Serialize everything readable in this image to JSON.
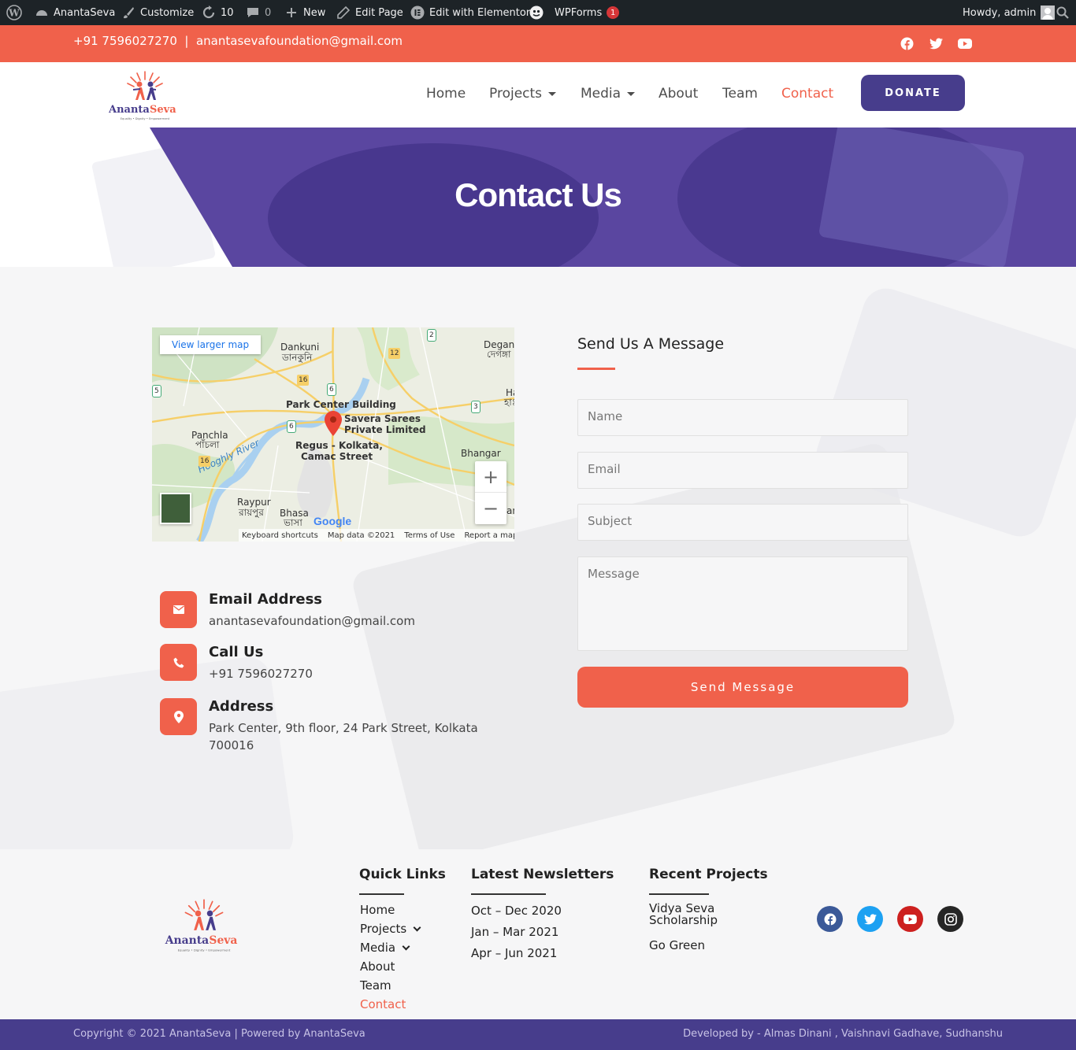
{
  "admin_bar": {
    "site_name": "AnantaSeva",
    "customize": "Customize",
    "updates_count": "10",
    "comments_count": "0",
    "new_label": "New",
    "edit_page": "Edit Page",
    "edit_elementor": "Edit with Elementor",
    "wpforms": "WPForms",
    "wpforms_badge": "1",
    "howdy": "Howdy, admin"
  },
  "topbar": {
    "contact_line": "+91 7596027270  |  anantasevafoundation@gmail.com",
    "social_icons": [
      "facebook-icon",
      "twitter-icon",
      "youtube-icon"
    ]
  },
  "brand": {
    "name": "Ananta Seva",
    "name_part1": "Ananta",
    "name_part2": "Seva",
    "tagline": "Equality • Dignity • Empowerment"
  },
  "nav": {
    "items": [
      {
        "label": "Home"
      },
      {
        "label": "Projects"
      },
      {
        "label": "Media"
      },
      {
        "label": "About"
      },
      {
        "label": "Team"
      },
      {
        "label": "Contact"
      }
    ],
    "donate_label": "DONATE"
  },
  "hero": {
    "title": "Contact Us"
  },
  "map": {
    "view_larger": "View larger map",
    "labels": {
      "dankuni": "Dankuni",
      "dankuni_bn": "ডানকুনি",
      "degang": "Degang",
      "degang_bn": "দেগঙ্গা",
      "park_center": "Park Center Building",
      "savera": "Savera Sarees",
      "savera2": "Private Limited",
      "regus": "Regus - Kolkata,",
      "regus2": "Camac Street",
      "panchla": "Panchla",
      "panchla_bn": "পাঁচলা",
      "bhangar": "Bhangar",
      "hooghly": "Hooghly River",
      "raypur": "Raypur",
      "raypur_bn": "রায়পুর",
      "bhasa": "Bhasa",
      "bhasa_bn": "ভাসা",
      "ha": "Ha",
      "ha_bn": "হাঃ",
      "an": "an",
      "road_16a": "16",
      "road_16b": "16",
      "road_6a": "6",
      "road_6b": "6",
      "road_12": "12",
      "road_2": "2",
      "road_3": "3",
      "road_5": "5"
    },
    "google": "Google",
    "keyboard": "Keyboard shortcuts",
    "mapdata": "Map data ©2021",
    "terms": "Terms of Use",
    "report": "Report a map error"
  },
  "contact_info": {
    "email_title": "Email Address",
    "email_value": "anantasevafoundation@gmail.com",
    "call_title": "Call Us",
    "call_value": "+91 7596027270",
    "address_title": "Address",
    "address_value": "Park Center, 9th floor, 24 Park Street, Kolkata 700016"
  },
  "form": {
    "title": "Send Us A Message",
    "name_placeholder": "Name",
    "email_placeholder": "Email",
    "subject_placeholder": "Subject",
    "message_placeholder": "Message",
    "submit": "Send Message"
  },
  "footer": {
    "quick_links_title": "Quick Links",
    "quick_links": [
      "Home",
      "Projects",
      "Media",
      "About",
      "Team",
      "Contact"
    ],
    "newsletters_title": "Latest Newsletters",
    "newsletters": [
      "Oct – Dec 2020",
      "Jan – Mar 2021",
      "Apr – Jun 2021"
    ],
    "projects_title": "Recent Projects",
    "projects": [
      "Vidya Seva Scholarship",
      "Go Green"
    ],
    "social_icons": [
      "facebook-icon",
      "twitter-icon",
      "youtube-icon",
      "instagram-icon"
    ],
    "colors": {
      "facebook": "#3b5998",
      "twitter": "#1da1f2",
      "youtube": "#cd201f",
      "instagram": "#262626"
    }
  },
  "bottom_bar": {
    "copyright": "Copyright © 2021 AnantaSeva | Powered by AnantaSeva",
    "developed": "Developed by - Almas Dinani , Vaishnavi Gadhave, Sudhanshu"
  },
  "colors": {
    "accent": "#f0614b",
    "brand_purple": "#473d8c",
    "hero_purple": "#5a46a0",
    "admin_bar": "#1d2327"
  }
}
